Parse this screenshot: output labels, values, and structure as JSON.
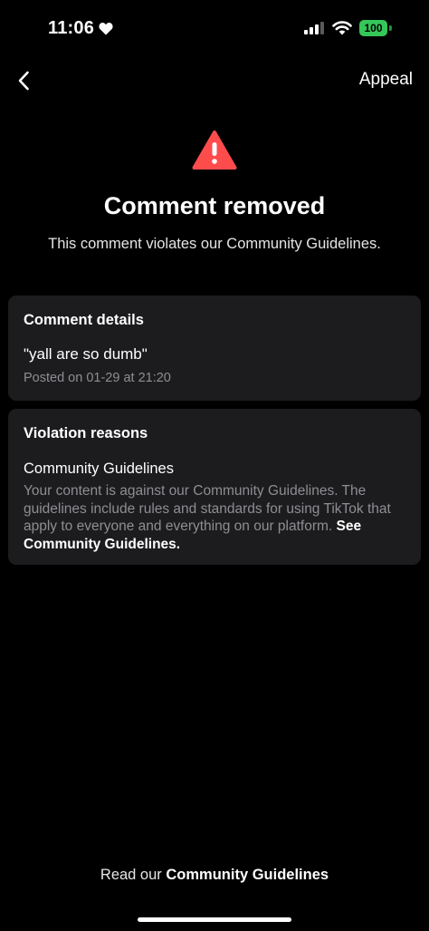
{
  "status_bar": {
    "time": "11:06",
    "battery": "100"
  },
  "nav": {
    "appeal_label": "Appeal"
  },
  "header": {
    "title": "Comment removed",
    "subtitle": "This comment violates our Community Guidelines."
  },
  "comment_details": {
    "title": "Comment details",
    "comment": "\"yall are so dumb\"",
    "posted": "Posted on 01-29 at 21:20"
  },
  "violation": {
    "title": "Violation reasons",
    "name": "Community Guidelines",
    "description": "Your content is against our Community Guidelines. The guidelines include rules and standards for using TikTok that apply to everyone and everything on our platform.",
    "link": "See Community Guidelines."
  },
  "footer": {
    "prefix": "Read our",
    "link": "Community Guidelines"
  },
  "colors": {
    "background": "#000000",
    "card": "#1c1c1e",
    "warning": "#fe2c55",
    "battery": "#34c759",
    "secondary_text": "#8e8e93"
  }
}
